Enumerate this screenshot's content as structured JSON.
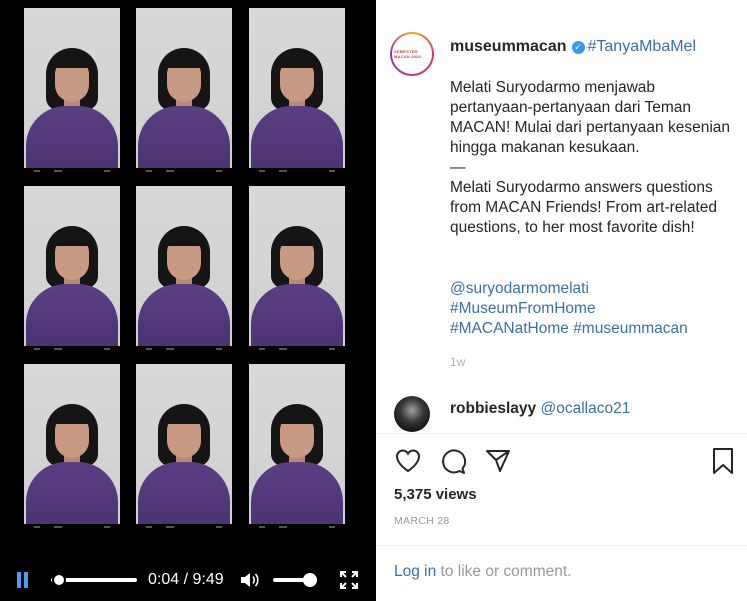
{
  "video": {
    "thumbnail_rows": 3,
    "thumbnail_cols": 3,
    "playing": true,
    "progress_fraction": 0.007,
    "volume_fraction": 0.85,
    "time_current": "0:04",
    "time_total": "9:49",
    "time_separator": "/",
    "icons": {
      "pause": "pause-icon",
      "volume": "volume-icon",
      "fullscreen": "fullscreen-icon"
    },
    "accent_color": "#4a9ff5"
  },
  "post": {
    "avatar_text": "SEMESTER MACAN 2020",
    "username": "museummacan",
    "verified": true,
    "header_hashtag": "#TanyaMbaMel",
    "caption_id": "Melati Suryodarmo menjawab pertanyaan-pertanyaan dari Teman MACAN! Mulai dari pertanyaan kesenian hingga makanan kesukaan.",
    "caption_dash": "—",
    "caption_en": "Melati Suryodarmo answers questions from MACAN Friends! From art-related questions, to her most favorite dish!",
    "mention": "@suryodarmomelati",
    "hashtag_1": "#MuseumFromHome",
    "hashtag_2": "#MACANatHome",
    "hashtag_3": "#museummacan",
    "age": "1w",
    "link_color": "#3b6fa8"
  },
  "comment": {
    "username": "robbieslayy",
    "mention": "@ocallaco21"
  },
  "actions": {
    "like_icon": "heart-icon",
    "comment_icon": "comment-icon",
    "share_icon": "share-icon",
    "save_icon": "bookmark-icon"
  },
  "stats": {
    "views": "5,375 views",
    "date": "MARCH 28"
  },
  "login": {
    "link": "Log in",
    "rest": "to like or comment."
  }
}
